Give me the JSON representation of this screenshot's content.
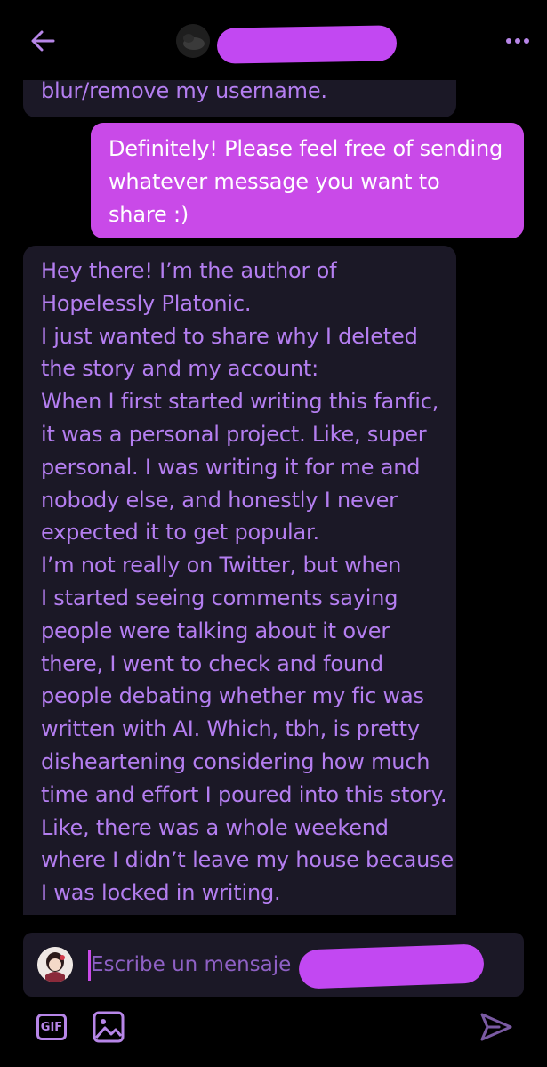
{
  "colors": {
    "accent": "#b786e8",
    "incoming_bubble": "#1b1826",
    "incoming_text": "#b47ef0",
    "outgoing_bubble": "#c94ae8",
    "redaction": "#c248f2"
  },
  "header": {
    "back_icon": "arrow-left-icon",
    "more_icon": "more-horizontal-icon"
  },
  "messages": [
    {
      "direction": "incoming",
      "lines": [
        "blur/remove my username."
      ]
    },
    {
      "direction": "outgoing",
      "lines": [
        "Definitely! Please feel free of sending",
        "whatever message you want to",
        "share :)"
      ]
    },
    {
      "direction": "incoming",
      "lines": [
        "Hey there! I’m the author of",
        "Hopelessly Platonic.",
        "I just wanted to share why I deleted",
        "the story and my account:",
        "When I first started writing this fanfic,",
        "it was a personal project. Like, super",
        "personal. I was writing it for me and",
        "nobody else, and honestly I never",
        "expected it to get popular.",
        "I’m not really on Twitter, but when",
        "I started seeing comments saying",
        "people were talking about it over",
        "there, I went to check and found",
        "people debating whether my fic was",
        "written with AI. Which, tbh, is pretty",
        "disheartening considering how much",
        "time and effort I poured into this story.",
        "Like, there was a whole weekend",
        "where I didn’t leave my house because",
        "I was locked in writing."
      ]
    }
  ],
  "composer": {
    "placeholder": "Escribe un mensaje",
    "gif_label": "GIF",
    "gif_icon": "gif-icon",
    "image_icon": "image-icon",
    "send_icon": "send-icon"
  }
}
